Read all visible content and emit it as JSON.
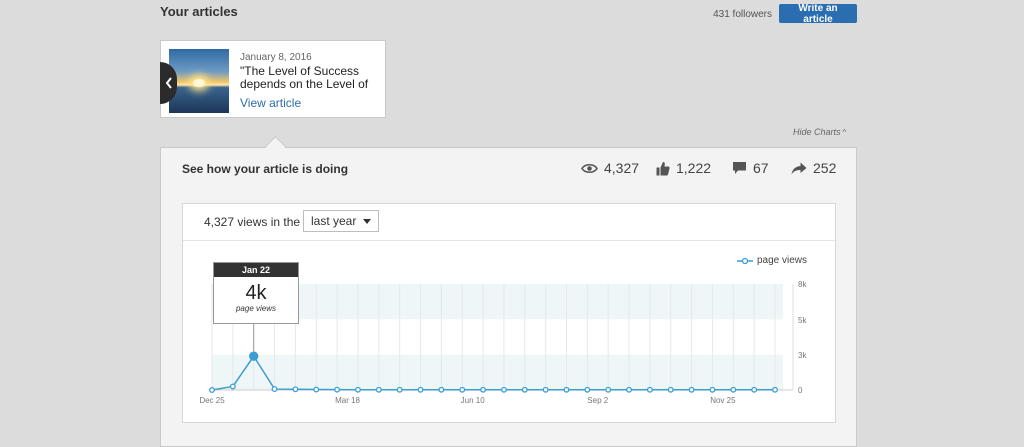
{
  "header": {
    "title": "Your articles",
    "followers": "431 followers",
    "write_button": "Write an article"
  },
  "article": {
    "date": "January 8, 2016",
    "title": "\"The Level of Success depends on the Level of",
    "link": "View article"
  },
  "hide_charts": "Hide Charts",
  "panel": {
    "heading": "See how your article is doing",
    "stats": {
      "views": "4,327",
      "likes": "1,222",
      "comments": "67",
      "shares": "252"
    }
  },
  "chart_header": {
    "views_text": "4,327 views in the",
    "range": "last year"
  },
  "tooltip": {
    "date": "Jan 22",
    "value": "4k",
    "label": "page views"
  },
  "colors": {
    "accent": "#2a6eb1",
    "series": "#3b9ed1",
    "dark": "#2b2b2b"
  },
  "chart_data": {
    "type": "line",
    "series": [
      {
        "name": "page views",
        "values": [
          0,
          150,
          1450,
          40,
          30,
          20,
          15,
          10,
          10,
          10,
          10,
          10,
          10,
          10,
          10,
          10,
          10,
          10,
          10,
          10,
          10,
          10,
          10,
          10,
          10,
          10,
          10,
          10
        ]
      }
    ],
    "x_ticks": [
      "Dec 25",
      "Mar 18",
      "Jun 10",
      "Sep 2",
      "Nov 25"
    ],
    "x_tick_index": [
      0,
      6.5,
      12.5,
      18.5,
      24.5
    ],
    "y_ticks": [
      "0",
      "3k",
      "5k",
      "8k"
    ],
    "ylim": [
      0,
      3000
    ],
    "highlight_index": 2,
    "legend_position": "top-right",
    "grid": true
  }
}
